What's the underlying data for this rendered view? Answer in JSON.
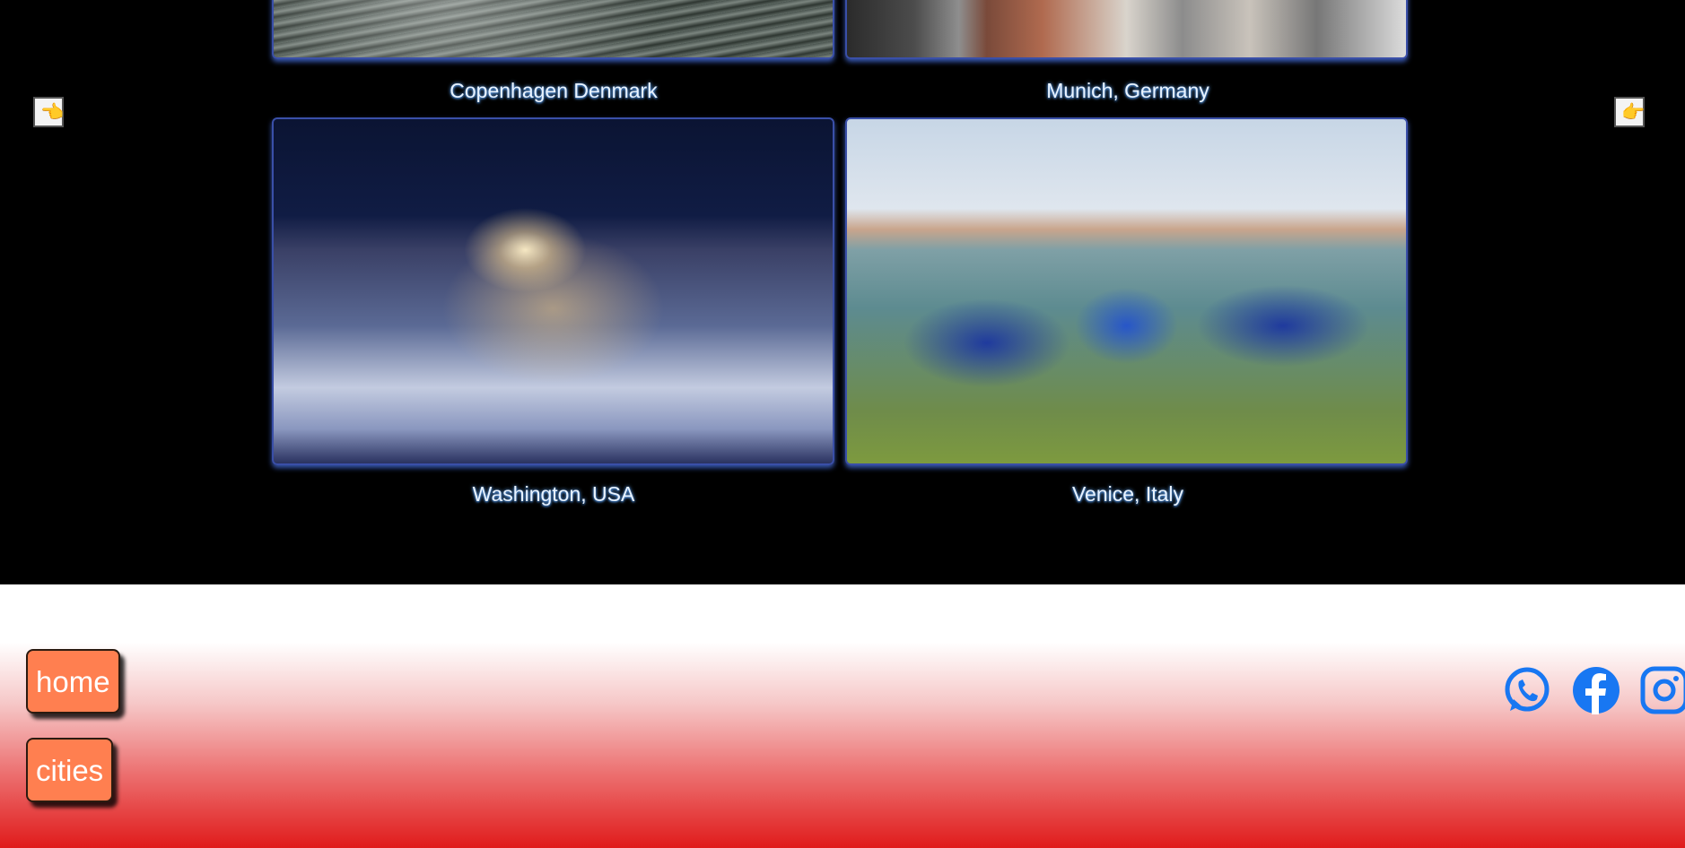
{
  "gallery": {
    "cities": [
      {
        "caption": "Copenhagen Denmark"
      },
      {
        "caption": "Munich, Germany"
      },
      {
        "caption": "Washington, USA"
      },
      {
        "caption": "Venice, Italy"
      }
    ],
    "prev_icon": "👈",
    "next_icon": "👉"
  },
  "footer": {
    "home_label": "home",
    "cities_label": "cities",
    "social": [
      "whatsapp-icon",
      "facebook-icon",
      "instagram-icon"
    ],
    "social_color": "#1877f2",
    "button_color": "#ff7f50"
  }
}
